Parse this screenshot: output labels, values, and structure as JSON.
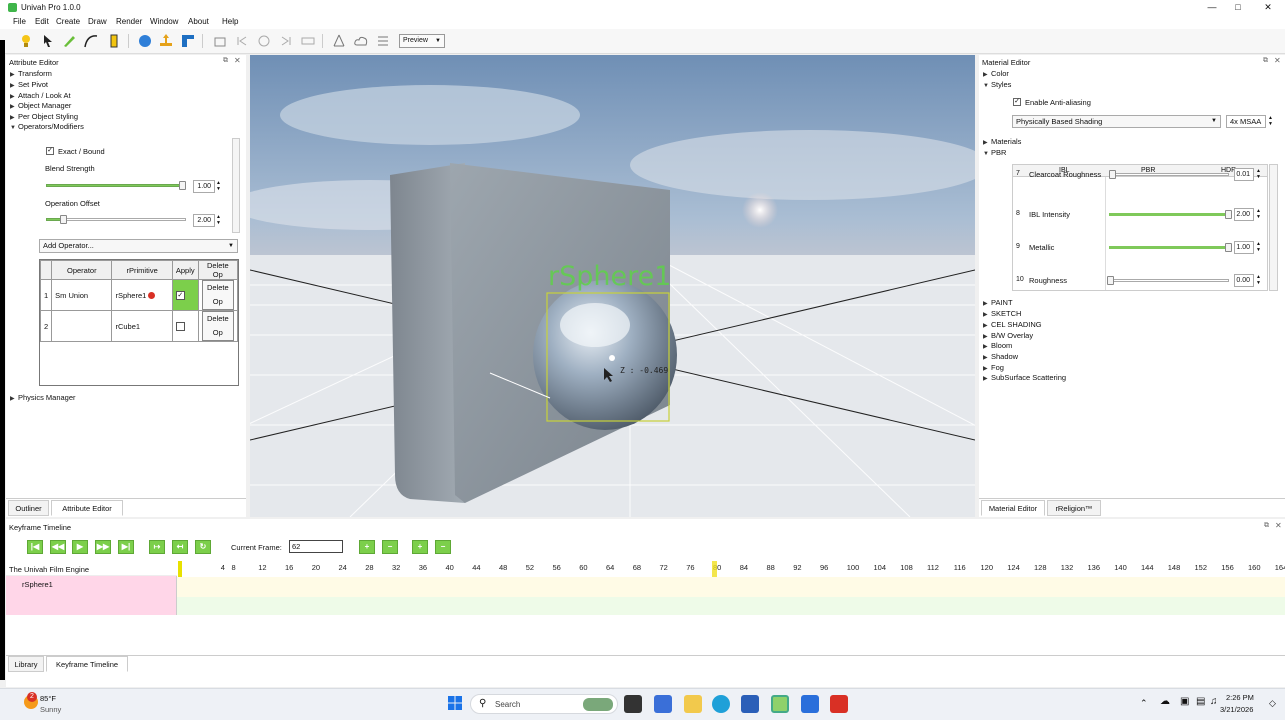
{
  "app": {
    "title": "Univah Pro 1.0.0"
  },
  "menu": [
    "File",
    "Edit",
    "Create",
    "Draw",
    "Render",
    "Window",
    "About",
    "Help"
  ],
  "toolbar": {
    "preview_label": "Preview"
  },
  "attribute_editor": {
    "title": "Attribute Editor",
    "items": [
      "Transform",
      "Set Pivot",
      "Attach / Look At",
      "Object Manager",
      "Per Object Styling",
      "Operators/Modifiers"
    ],
    "exact_bound_label": "Exact / Bound",
    "exact_bound_checked": true,
    "blend_strength_label": "Blend Strength",
    "blend_strength_value": "1.00",
    "blend_strength_fraction": 0.98,
    "operation_offset_label": "Operation Offset",
    "operation_offset_value": "2.00",
    "operation_offset_fraction": 0.13,
    "add_operator_label": "Add Operator...",
    "table": {
      "headers": [
        "Operator",
        "rPrimitive",
        "Apply",
        "Delete Op"
      ],
      "rows": [
        {
          "num": "1",
          "operator": "Sm Union",
          "primitive": "rSphere1",
          "apply": true,
          "delete": "Delete Op"
        },
        {
          "num": "2",
          "operator": "",
          "primitive": "rCube1",
          "apply": false,
          "delete": "Delete Op"
        }
      ]
    },
    "physics_manager": "Physics Manager",
    "tabs": [
      "Outliner",
      "Attribute Editor"
    ]
  },
  "viewport": {
    "label": "rSphere1",
    "coord_readout": "Z : -0.469"
  },
  "material_editor": {
    "title": "Material Editor",
    "color_label": "Color",
    "styles_label": "Styles",
    "anti_alias_label": "Enable Anti-aliasing",
    "anti_alias_checked": true,
    "shading_select": "Physically Based Shading",
    "msaa_select": "4x MSAA",
    "materials_label": "Materials",
    "pbr_label": "PBR",
    "pbr_tabs": [
      "IBL",
      "PBR",
      "HDR"
    ],
    "pbr_rows": [
      {
        "num": "7",
        "label": "Clearcoat Roughness",
        "value": "0.01",
        "fraction": 0.02
      },
      {
        "num": "8",
        "label": "IBL Intensity",
        "value": "2.00",
        "fraction": 0.98
      },
      {
        "num": "9",
        "label": "Metallic",
        "value": "1.00",
        "fraction": 0.98
      },
      {
        "num": "10",
        "label": "Roughness",
        "value": "0.00",
        "fraction": 0.0
      }
    ],
    "sections": [
      "PAINT",
      "SKETCH",
      "CEL SHADING",
      "B/W Overlay",
      "Bloom",
      "Shadow",
      "Fog",
      "SubSurface Scattering"
    ],
    "tabs": [
      "Material Editor",
      "rReligion™"
    ]
  },
  "timeline": {
    "title": "Keyframe Timeline",
    "current_frame_label": "Current Frame:",
    "current_frame_value": "62",
    "track_root": "The Univah Film Engine",
    "track_child": "rSphere1",
    "ruler": [
      "4",
      "8",
      "12",
      "16",
      "20",
      "24",
      "28",
      "32",
      "36",
      "40",
      "44",
      "48",
      "52",
      "56",
      "60",
      "64",
      "68",
      "72",
      "76",
      "80",
      "84",
      "88",
      "92",
      "96",
      "100",
      "104",
      "108",
      "112",
      "116",
      "120",
      "124",
      "128",
      "132",
      "136",
      "140",
      "144",
      "148",
      "152",
      "156",
      "160",
      "164"
    ],
    "tabs": [
      "Library",
      "Keyframe Timeline"
    ]
  },
  "taskbar": {
    "weather_temp": "85°F",
    "weather_desc": "Sunny",
    "weather_badge": "2",
    "search_placeholder": "Search",
    "time": "2:26 PM",
    "date": "3/21/2026"
  },
  "colors": {
    "accent_green": "#7ccf4b",
    "selection_yellow": "#c8d23a",
    "track_pink": "#ffd6e8"
  }
}
